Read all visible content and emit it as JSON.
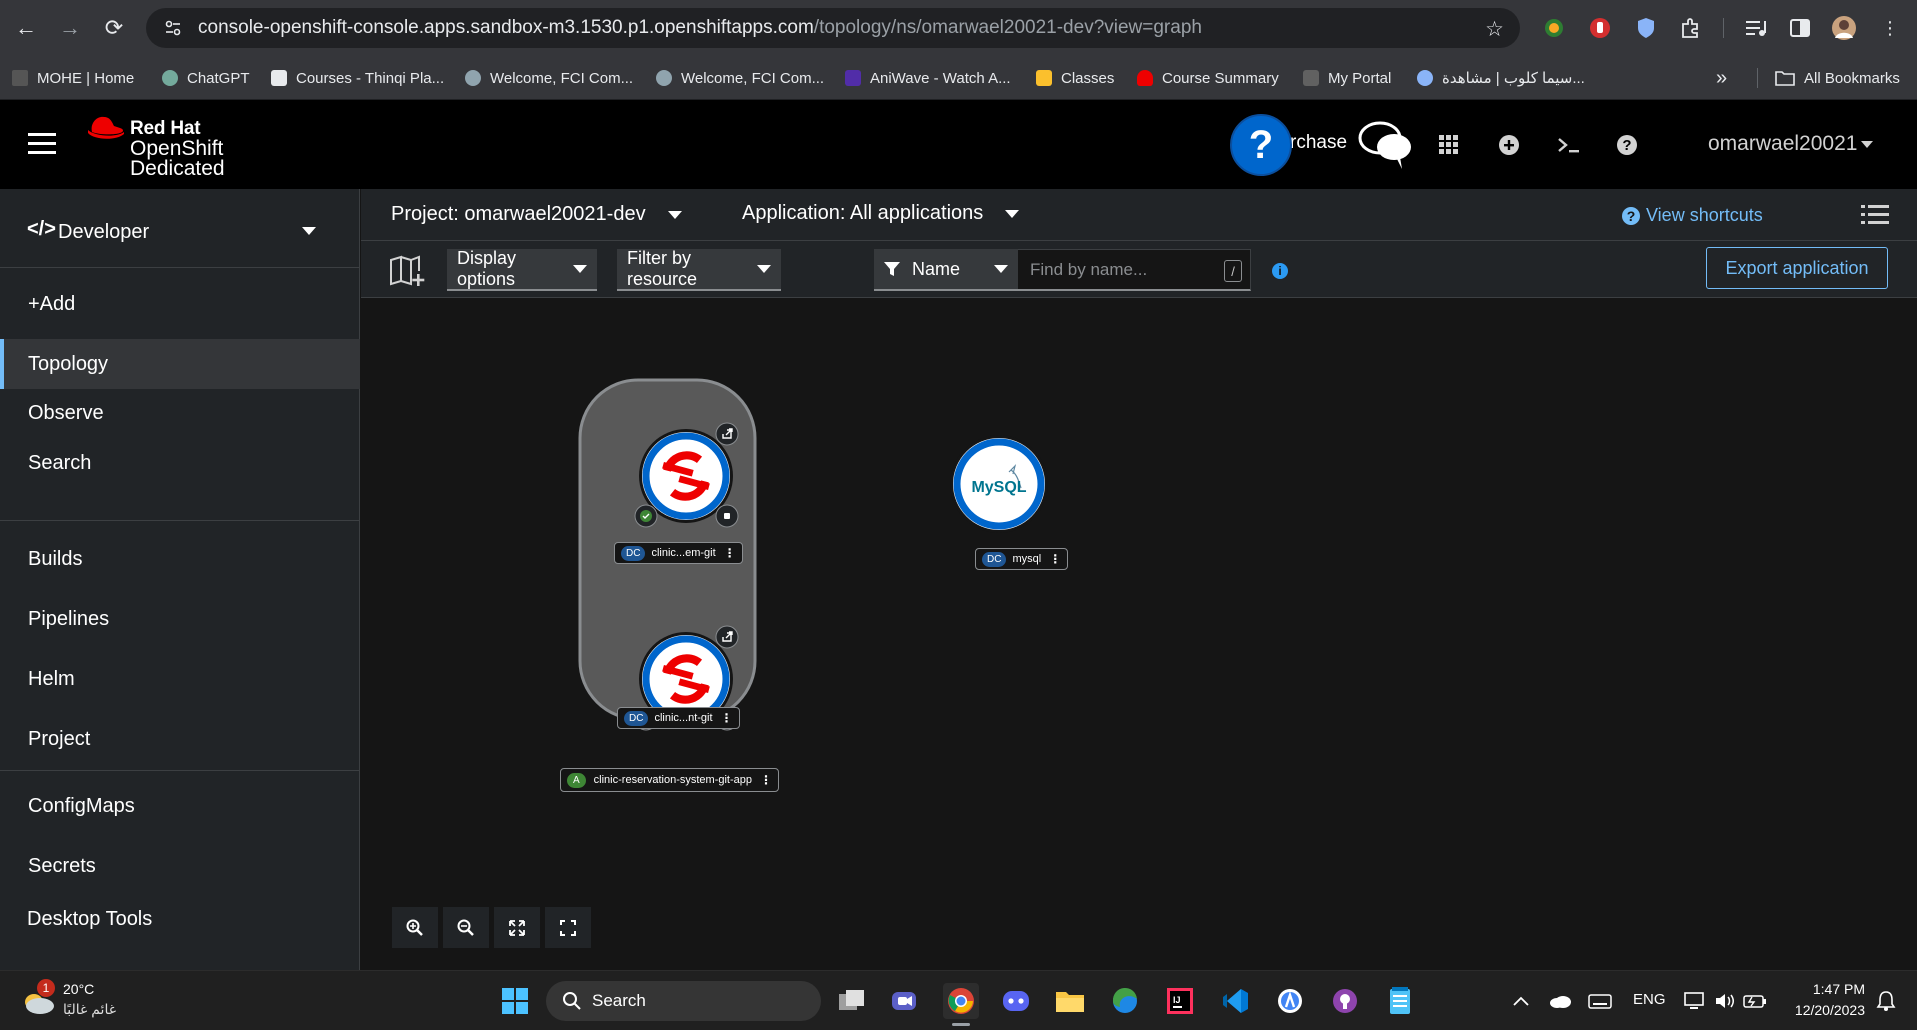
{
  "browser": {
    "url_host": "console-openshift-console.apps.sandbox-m3.1530.p1.openshiftapps.com",
    "url_path": "/topology/ns/omarwael20021-dev?view=graph",
    "bookmarks": [
      "MOHE | Home",
      "ChatGPT",
      "Courses - Thinqi Pla...",
      "Welcome, FCI Com...",
      "Welcome, FCI Com...",
      "AniWave - Watch A...",
      "Classes",
      "Course Summary",
      "My Portal",
      "سيما كلوب | مشاهدة..."
    ],
    "more_bookmarks": "»",
    "all_bookmarks": "All Bookmarks"
  },
  "masthead": {
    "brand_line1": "Red Hat",
    "brand_line2": "OpenShift",
    "brand_line3": "Dedicated",
    "help_mark": "?",
    "purchase_text": "rchase",
    "user": "omarwael20021"
  },
  "sidebar": {
    "perspective": "Developer",
    "items": [
      "+Add",
      "Topology",
      "Observe",
      "Search",
      "Builds",
      "Pipelines",
      "Helm",
      "Project",
      "ConfigMaps",
      "Secrets",
      "Desktop Tools"
    ],
    "active": "Topology"
  },
  "content": {
    "project": "Project: omarwael20021-dev",
    "application": "Application: All applications",
    "view_shortcuts": "View shortcuts",
    "display_options": "Display options",
    "filter_by_resource": "Filter by resource",
    "filter_type": "Name",
    "find_placeholder": "Find by name...",
    "slash": "/",
    "export_button": "Export application"
  },
  "topology": {
    "group_label": "clinic-reservation-system-git-app",
    "group_badge": "A",
    "nodes": [
      {
        "badge": "DC",
        "label": "clinic...em-git"
      },
      {
        "badge": "DC",
        "label": "clinic...nt-git"
      },
      {
        "badge": "DC",
        "label": "mysql",
        "icon_text": "MySQL"
      }
    ]
  },
  "taskbar": {
    "weather_temp": "20°C",
    "weather_desc": "غائم غالبًا",
    "weather_badge": "1",
    "search": "Search",
    "lang": "ENG",
    "time": "1:47 PM",
    "date": "12/20/2023"
  },
  "colors": {
    "accent_blue": "#73bcf7",
    "node_ring": "#0066cc",
    "redhat_red": "#ee0000",
    "status_green": "#3e8635"
  }
}
